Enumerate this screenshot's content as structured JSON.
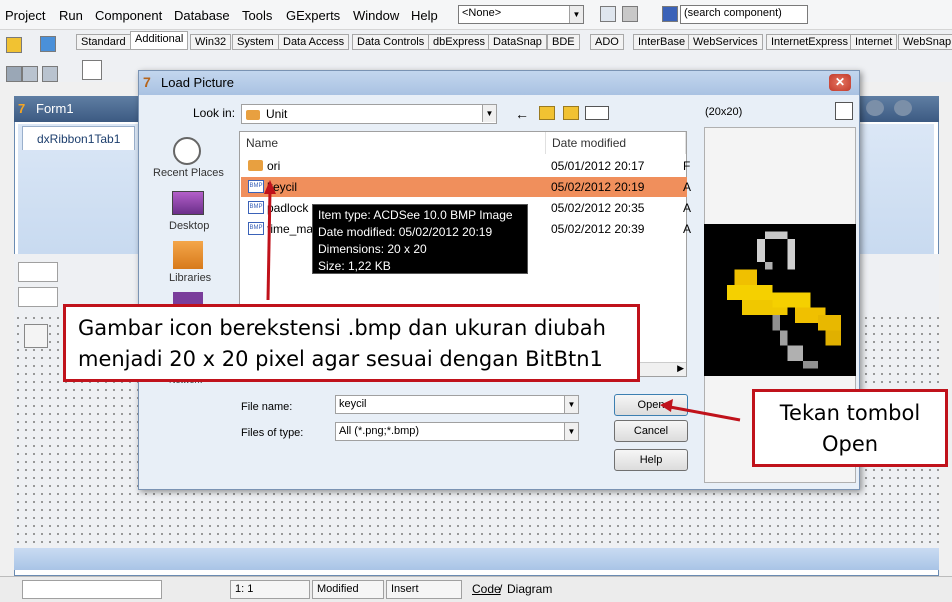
{
  "menu": [
    "Project",
    "Run",
    "Component",
    "Database",
    "Tools",
    "GExperts",
    "Window",
    "Help"
  ],
  "toolbar": {
    "config_combo": "<None>",
    "search_component": "(search component)",
    "palette_tabs": [
      "Standard",
      "Additional",
      "Win32",
      "System",
      "Data Access",
      "Data Controls",
      "dbExpress",
      "DataSnap",
      "BDE",
      "ADO",
      "InterBase",
      "WebServices",
      "InternetExpress",
      "Internet",
      "WebSnap"
    ],
    "active_tab": "Additional"
  },
  "form": {
    "title": "Form1",
    "ribbon_tab": "dxRibbon1Tab1"
  },
  "dialog": {
    "title": "Load Picture",
    "look_in_label": "Look in:",
    "look_in_value": "Unit",
    "preview_size": "(20x20)",
    "places": [
      "Recent Places",
      "Desktop",
      "Libraries",
      "Network"
    ],
    "columns": {
      "name": "Name",
      "date": "Date modified"
    },
    "files": [
      {
        "name": "ori",
        "date": "05/01/2012 20:17",
        "extra": "F",
        "type": "folder"
      },
      {
        "name": "keycil",
        "date": "05/02/2012 20:19",
        "extra": "A",
        "type": "bmp"
      },
      {
        "name": "padlock",
        "date": "05/02/2012 20:35",
        "extra": "A",
        "type": "bmp"
      },
      {
        "name": "time_ma",
        "date": "05/02/2012 20:39",
        "extra": "A",
        "type": "bmp"
      }
    ],
    "selected_file": "keycil",
    "tooltip": [
      "Item type: ACDSee 10.0 BMP Image",
      "Date modified: 05/02/2012 20:19",
      "Dimensions: 20 x 20",
      "Size: 1,22 KB"
    ],
    "file_name_label": "File name:",
    "file_name_value": "keycil",
    "file_type_label": "Files of type:",
    "file_type_value": "All (*.png;*.bmp)",
    "buttons": {
      "open": "Open",
      "cancel": "Cancel",
      "help": "Help"
    }
  },
  "annotations": {
    "note1": "Gambar icon berekstensi .bmp dan ukuran diubah menjadi 20 x 20 pixel agar sesuai dengan BitBtn1",
    "note2": "Tekan tombol Open",
    "accent_color": "#c0121b"
  },
  "statusbar": {
    "position": "1:   1",
    "state": "Modified",
    "mode": "Insert",
    "tab_code": "Code",
    "tab_diagram": "Diagram"
  },
  "colors": {
    "selection": "#f08f5c",
    "folder": "#e8a040",
    "title_blue": "#3c5a82"
  }
}
